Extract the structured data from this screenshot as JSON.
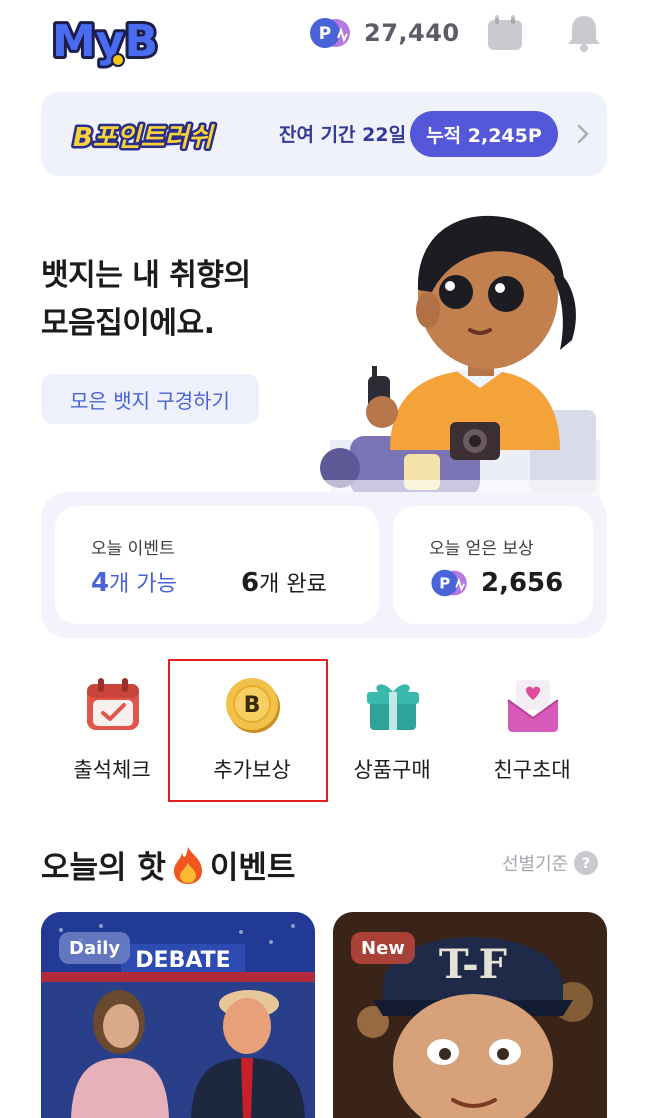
{
  "header": {
    "logo_text": "MyB",
    "points": "27,440",
    "icons": {
      "calendar": "calendar-icon",
      "bell": "bell-icon",
      "points": "point-coin-icon"
    }
  },
  "banner": {
    "logo_text": "B포인트러쉬",
    "period": "잔여 기간 22일",
    "accumulated": "누적 2,245P"
  },
  "hero": {
    "title_line1": "뱃지는 내 취향의",
    "title_line2": "모음집이에요.",
    "button": "모은 뱃지 구경하기"
  },
  "stats": {
    "events_label": "오늘 이벤트",
    "possible_count": "4",
    "possible_suffix": "개 가능",
    "done_count": "6",
    "done_suffix": "개 완료",
    "reward_label": "오늘 얻은 보상",
    "reward_value": "2,656"
  },
  "quick_menu": [
    {
      "label": "출석체크",
      "icon": "attendance-calendar-icon"
    },
    {
      "label": "추가보상",
      "icon": "bonus-coin-icon"
    },
    {
      "label": "상품구매",
      "icon": "gift-box-icon"
    },
    {
      "label": "친구초대",
      "icon": "invite-envelope-icon"
    }
  ],
  "section": {
    "title_before": "오늘의 핫",
    "title_after": "이벤트",
    "sort_label": "선별기준"
  },
  "cards": [
    {
      "badge": "Daily",
      "image_text": "DEBATE"
    },
    {
      "badge": "New",
      "image_text": "T-F"
    }
  ],
  "colors": {
    "accent": "#5457d8",
    "accent_text": "#4a63d8",
    "highlight": "#e0201f",
    "banner_bg": "#eff1fb"
  }
}
